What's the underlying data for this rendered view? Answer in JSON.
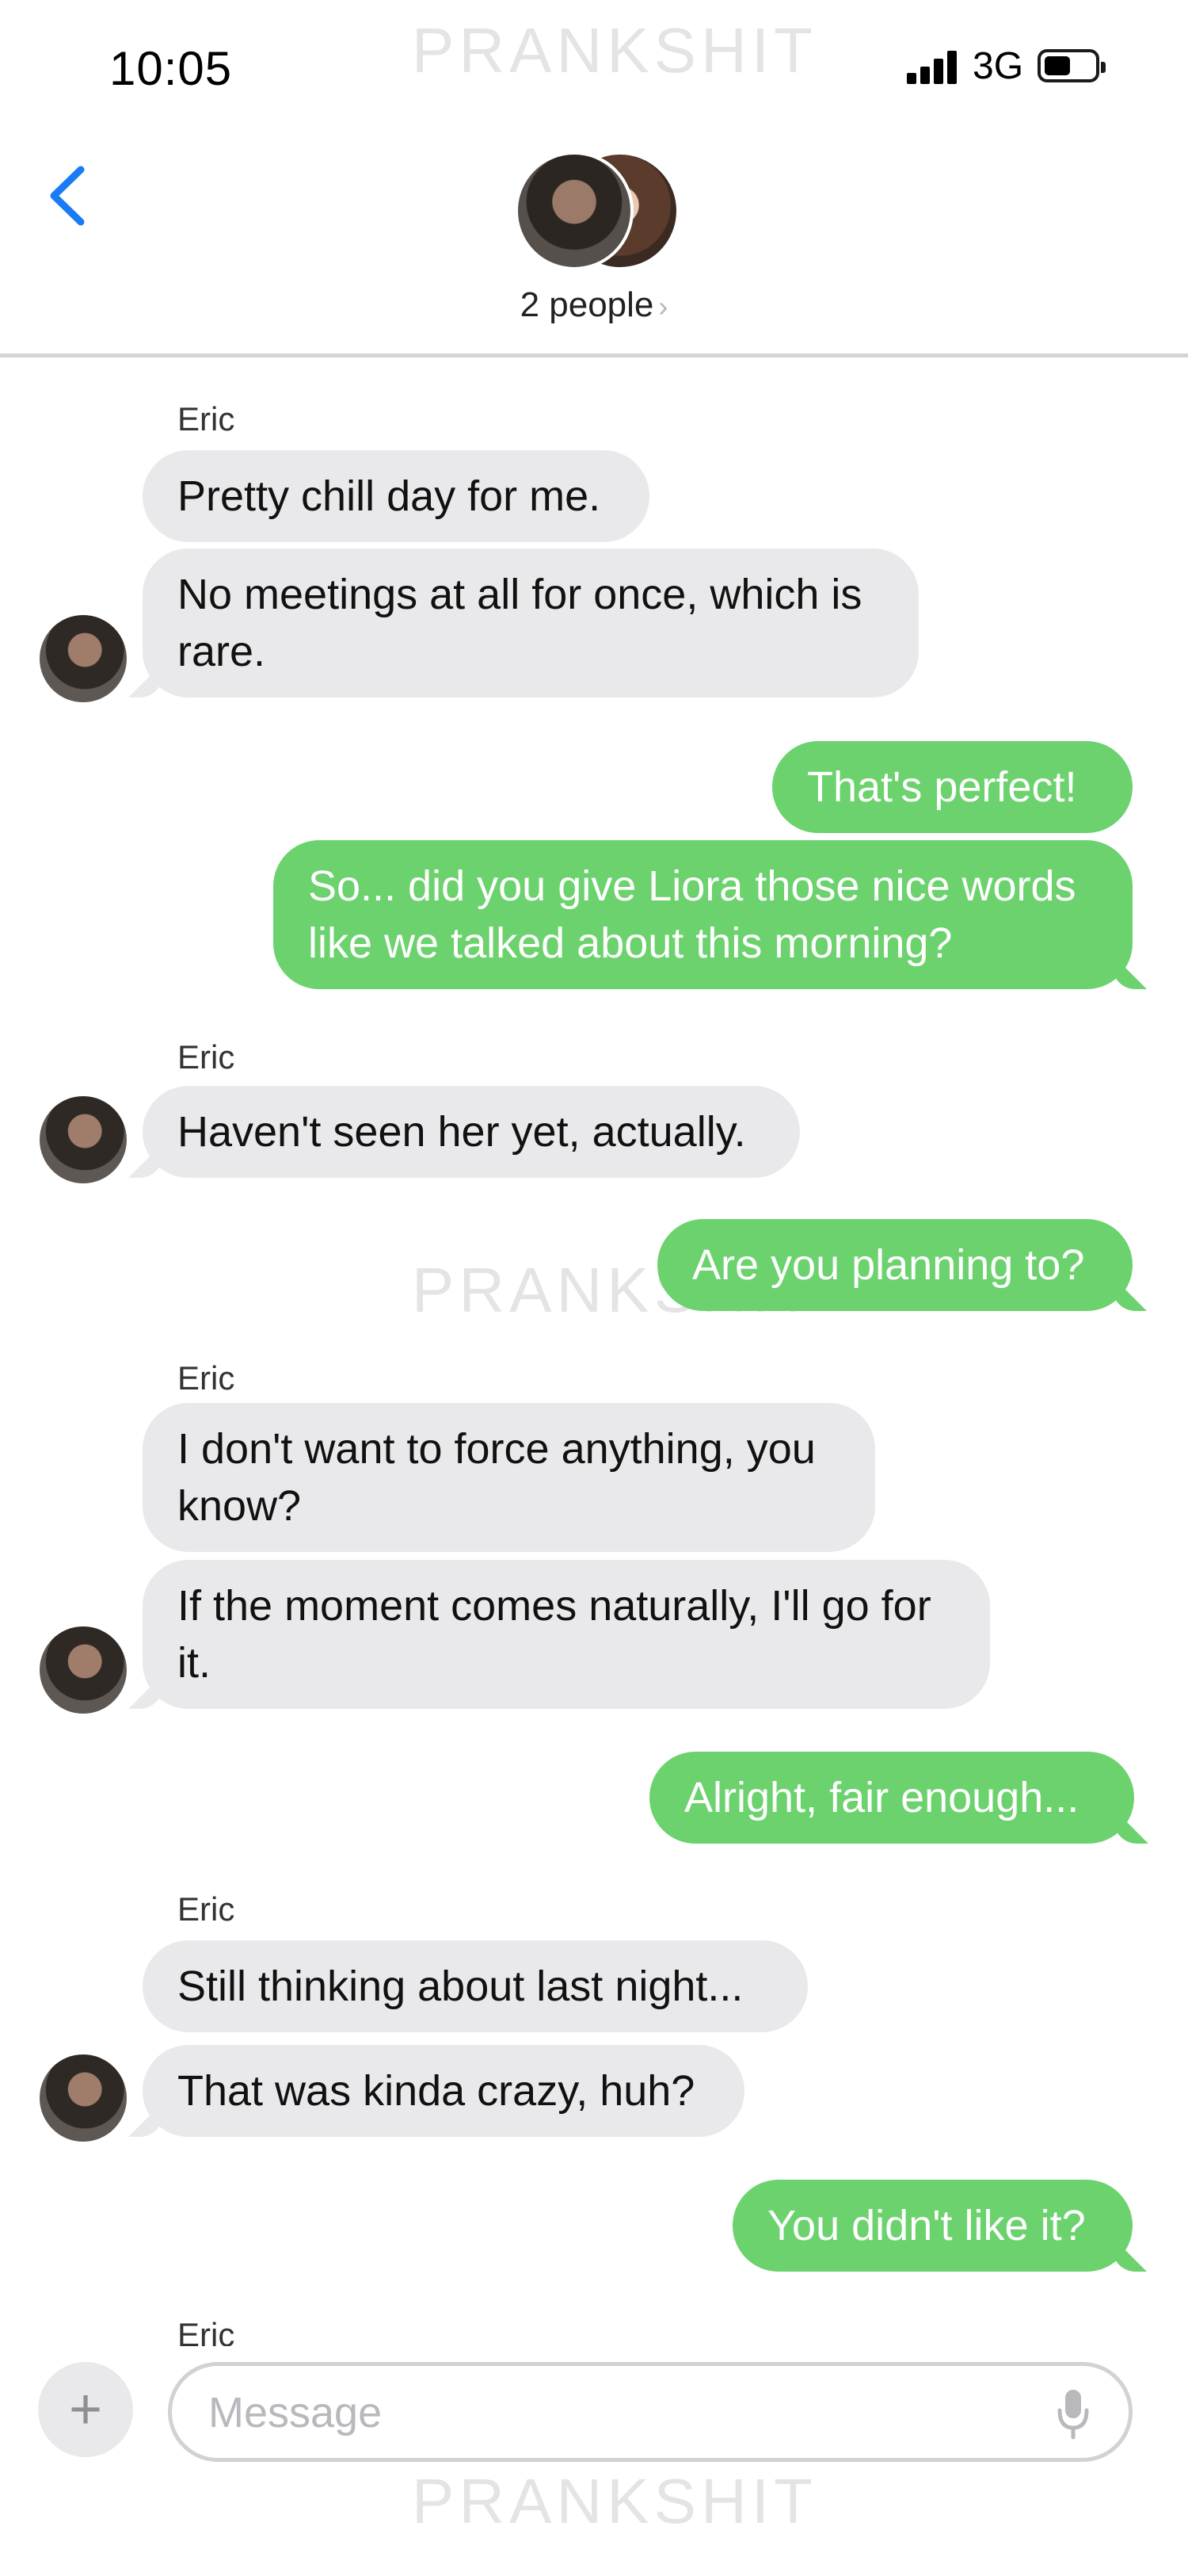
{
  "status_bar": {
    "time": "10:05",
    "network": "3G",
    "watermark": "PRANKSHIT"
  },
  "header": {
    "title": "2 people",
    "chevron": "›"
  },
  "messages": [
    {
      "sender": "Eric",
      "bubbles": [
        "Pretty chill day for me.",
        "No meetings at all for once, which is rare."
      ]
    },
    {
      "outgoing": [
        "That's perfect!",
        "So... did you give Liora those nice words like we talked about this morning?"
      ]
    },
    {
      "sender": "Eric",
      "bubbles": [
        "Haven't seen her yet, actually."
      ]
    },
    {
      "outgoing": [
        "Are you planning to?"
      ]
    },
    {
      "sender": "Eric",
      "bubbles": [
        "I don't want to force anything, you know?",
        "If the moment comes naturally, I'll go for it."
      ]
    },
    {
      "outgoing": [
        "Alright, fair enough..."
      ]
    },
    {
      "sender": "Eric",
      "bubbles": [
        "Still thinking about last night...",
        "That was kinda crazy, huh?"
      ]
    },
    {
      "outgoing": [
        "You didn't like it?"
      ]
    },
    {
      "sender": "Eric"
    }
  ],
  "composer": {
    "placeholder": "Message",
    "plus": "+"
  },
  "colors": {
    "outgoing": "#6cd26e",
    "incoming": "#e9e9eb",
    "accent": "#1a7cf5"
  }
}
